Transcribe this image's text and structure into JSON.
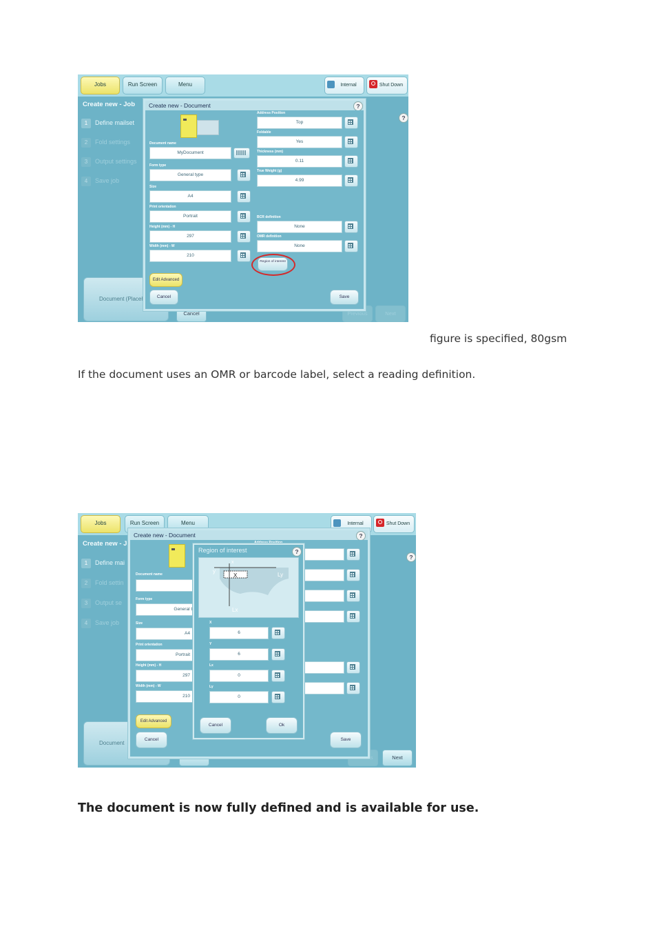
{
  "text": {
    "caption_fragment": "figure is specified, 80gsm",
    "omr_sentence": "If the document uses an OMR or barcode label, select a reading definition.",
    "final_note": "The document is now fully defined and is available for use."
  },
  "screen1": {
    "top": {
      "jobs": "Jobs",
      "run_screen": "Run Screen",
      "menu": "Menu",
      "internal": "Internal",
      "shut_down": "Shut Down"
    },
    "job_title": "Create new - Job",
    "steps": [
      {
        "num": "1",
        "label": "Define mailset"
      },
      {
        "num": "2",
        "label": "Fold settings"
      },
      {
        "num": "3",
        "label": "Output settings"
      },
      {
        "num": "4",
        "label": "Save job"
      }
    ],
    "help": "?",
    "document_tile": "Document (Placeh",
    "bottom": {
      "cancel": "Cancel",
      "previous": "Previous",
      "next": "Next"
    },
    "dialog": {
      "title": "Create new - Document",
      "help": "?",
      "left_fields": [
        {
          "label": "Document name",
          "value": "MyDocument"
        },
        {
          "label": "Form type",
          "value": "General type"
        },
        {
          "label": "Size",
          "value": "A4"
        },
        {
          "label": "Print orientation",
          "value": "Portrait"
        },
        {
          "label": "Height (mm) - H",
          "value": "297"
        },
        {
          "label": "Width (mm) - W",
          "value": "210"
        }
      ],
      "right_fields": [
        {
          "label": "Address Position",
          "value": "Top"
        },
        {
          "label": "Foldable",
          "value": "Yes"
        },
        {
          "label": "Thickness (mm)",
          "value": "0.11"
        },
        {
          "label": "True Weight (g)",
          "value": "4.99"
        },
        {
          "label": "BCR definition",
          "value": "None"
        },
        {
          "label": "OMR definition",
          "value": "None"
        }
      ],
      "region_button": "Region of interest",
      "edit_advanced": "Edit Advanced",
      "cancel": "Cancel",
      "save": "Save"
    }
  },
  "screen2": {
    "top": {
      "jobs": "Jobs",
      "run_screen": "Run Screen",
      "menu": "Menu",
      "internal": "Internal",
      "shut_down": "Shut Down"
    },
    "job_title": "Create new - J",
    "steps": [
      {
        "num": "1",
        "label": "Define mai"
      },
      {
        "num": "2",
        "label": "Fold settin"
      },
      {
        "num": "3",
        "label": "Output se"
      },
      {
        "num": "4",
        "label": "Save job"
      }
    ],
    "help": "?",
    "document_tile": "Document",
    "bottom": {
      "cancel": "Cancel",
      "previous": "Previous",
      "next": "Next"
    },
    "dialog": {
      "title": "Create new - Document",
      "help": "?",
      "right_label": "Address Position",
      "left_fields": [
        {
          "label": "Document name",
          "value": ""
        },
        {
          "label": "Form type",
          "value": "General typ"
        },
        {
          "label": "Size",
          "value": "A4"
        },
        {
          "label": "Print orientation",
          "value": "Portrait"
        },
        {
          "label": "Height (mm) - H",
          "value": "297"
        },
        {
          "label": "Width (mm) - W",
          "value": "210"
        }
      ],
      "edit_advanced": "Edit Advanced",
      "cancel": "Cancel",
      "save": "Save"
    },
    "roi": {
      "title": "Region of interest",
      "help": "?",
      "diagram": {
        "x": "x",
        "y": "y",
        "ly": "Ly",
        "lx": "Lx",
        "marker": "X"
      },
      "fields": [
        {
          "label": "X",
          "value": "6"
        },
        {
          "label": "Y",
          "value": "6"
        },
        {
          "label": "Lx",
          "value": "0"
        },
        {
          "label": "Ly",
          "value": "0"
        }
      ],
      "cancel": "Cancel",
      "ok": "Ok"
    }
  }
}
